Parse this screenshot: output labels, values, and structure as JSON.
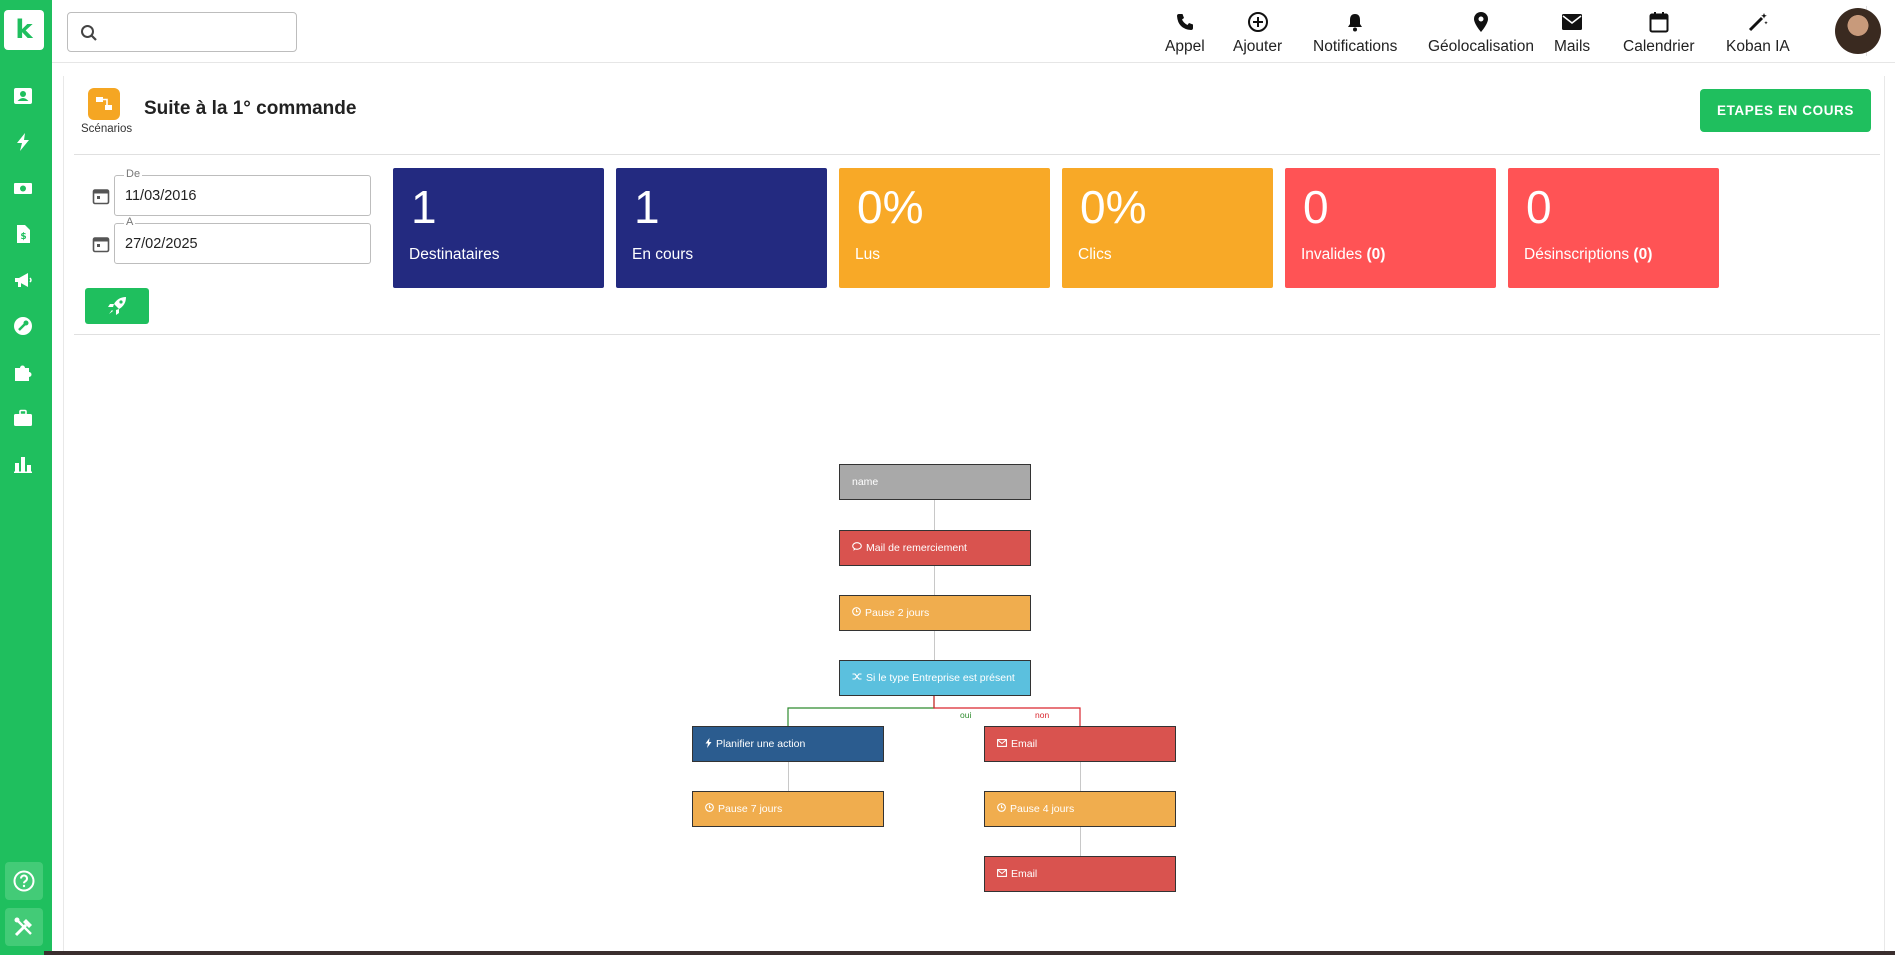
{
  "sidebar": {
    "logo": "k",
    "icons": [
      "contacts-icon",
      "bolt-icon",
      "money-icon",
      "document-dollar-icon",
      "megaphone-icon",
      "tools-icon",
      "puzzle-icon",
      "briefcase-icon",
      "bar-chart-icon"
    ],
    "bottom": [
      "help-icon",
      "settings-tools-icon"
    ],
    "colors": {
      "bg": "#1fbf5e"
    }
  },
  "topbar": {
    "search": {
      "placeholder": "",
      "value": ""
    },
    "nav": [
      {
        "label": "Appel",
        "icon": "phone-icon"
      },
      {
        "label": "Ajouter",
        "icon": "plus-circle-icon"
      },
      {
        "label": "Notifications",
        "icon": "bell-icon"
      },
      {
        "label": "Géolocalisation",
        "icon": "location-pin-icon"
      },
      {
        "label": "Mails",
        "icon": "mail-icon"
      },
      {
        "label": "Calendrier",
        "icon": "calendar-icon"
      },
      {
        "label": "Koban IA",
        "icon": "magic-wand-icon"
      }
    ]
  },
  "header": {
    "module_label": "Scénarios",
    "title": "Suite à la 1° commande",
    "action_button": "ETAPES EN COURS"
  },
  "filters": {
    "from": {
      "legend": "De",
      "value": "11/03/2016"
    },
    "to": {
      "legend": "A",
      "value": "27/02/2025"
    }
  },
  "stats": [
    {
      "value": "1",
      "label": "Destinataires",
      "count": "",
      "color": "#232a80"
    },
    {
      "value": "1",
      "label": "En cours",
      "count": "",
      "color": "#232a80"
    },
    {
      "value": "0%",
      "label": "Lus",
      "count": "",
      "color": "#f8a927"
    },
    {
      "value": "0%",
      "label": "Clics",
      "count": "",
      "color": "#f8a927"
    },
    {
      "value": "0",
      "label": "Invalides ",
      "count": "(0)",
      "color": "#ff5355"
    },
    {
      "value": "0",
      "label": "Désinscriptions ",
      "count": "(0)",
      "color": "#ff5355"
    }
  ],
  "flow": {
    "nodes": [
      {
        "id": "start",
        "text": "name",
        "icon": "",
        "color": "#a9a9a9"
      },
      {
        "id": "mail",
        "text": "Mail de remerciement",
        "icon": "comment-icon",
        "color": "#d9534f"
      },
      {
        "id": "pause2",
        "text": "Pause 2 jours",
        "icon": "clock-icon",
        "color": "#f0ad4e"
      },
      {
        "id": "cond",
        "text": "Si le type Entreprise est présent",
        "icon": "shuffle-icon",
        "color": "#5bc0de"
      },
      {
        "id": "plan",
        "text": "Planifier une action",
        "icon": "bolt-icon",
        "color": "#2b5c8f"
      },
      {
        "id": "pause7",
        "text": "Pause 7 jours",
        "icon": "clock-icon",
        "color": "#f0ad4e"
      },
      {
        "id": "email1",
        "text": "Email",
        "icon": "envelope-icon",
        "color": "#d9534f"
      },
      {
        "id": "pause4",
        "text": "Pause 4 jours",
        "icon": "clock-icon",
        "color": "#f0ad4e"
      },
      {
        "id": "email2",
        "text": "Email",
        "icon": "envelope-icon",
        "color": "#d9534f"
      }
    ],
    "branches": {
      "yes": "oui",
      "no": "non",
      "yes_color": "#2e8b2e",
      "no_color": "#d9262e"
    }
  }
}
